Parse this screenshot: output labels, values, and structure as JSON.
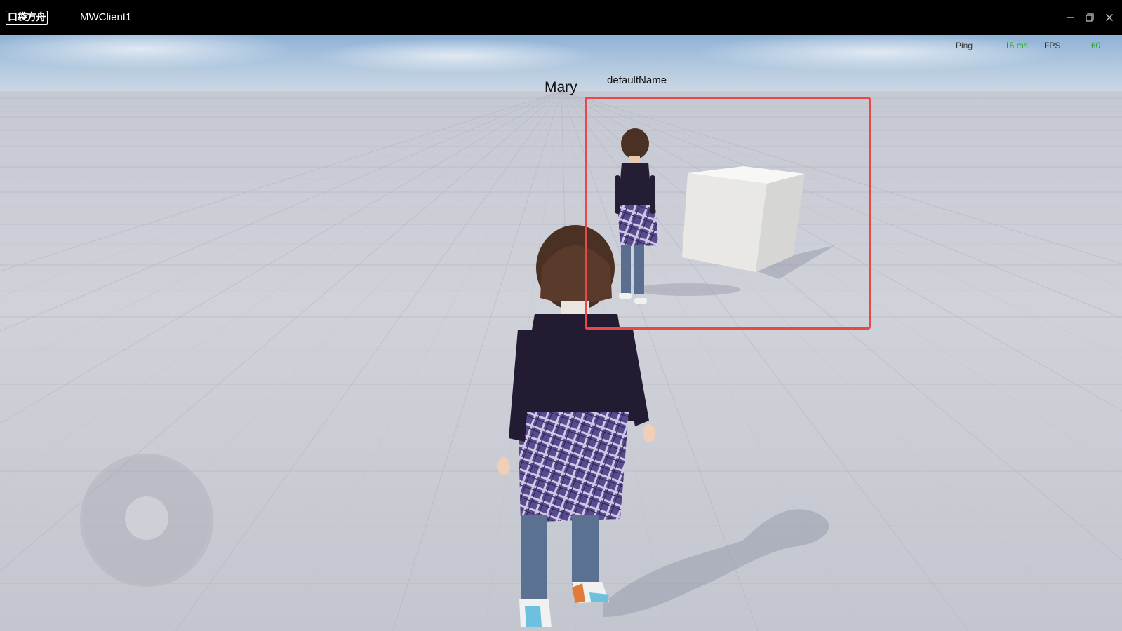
{
  "window": {
    "logo_text": "口袋方舟",
    "title": "MWClient1",
    "controls": {
      "minimize_icon": "minimize-icon",
      "restore_icon": "restore-icon",
      "close_icon": "close-icon"
    }
  },
  "hud": {
    "ping_label": "Ping",
    "ping_value": "15 ms",
    "fps_label": "FPS",
    "fps_value": "60",
    "value_color": "#17a81c"
  },
  "scene": {
    "player_name": "Mary",
    "selected_object_name": "defaultName",
    "selection_color": "#e9474a"
  },
  "joystick": {
    "icon": "virtual-joystick"
  }
}
